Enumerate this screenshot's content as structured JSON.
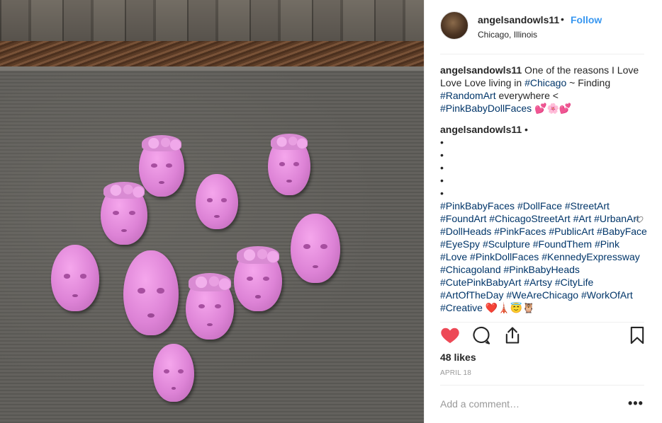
{
  "post": {
    "username": "angelsandowls11",
    "dot": "•",
    "follow_label": "Follow",
    "location": "Chicago, Illinois"
  },
  "caption": {
    "user": "angelsandowls11",
    "text_1": " One of the reasons I Love Love Love living in ",
    "tag_chicago": "#Chicago",
    "text_2": " ~ Finding ",
    "tag_randomart": "#RandomArt",
    "text_3": " everywhere < ",
    "tag_pinkbabydollfaces": "#PinkBabyDollFaces",
    "emoji_1": " 💕🌸💕"
  },
  "comment": {
    "user": "angelsandowls11",
    "dot": " •",
    "bullets": [
      "•",
      "•",
      "•",
      "•",
      "•"
    ],
    "hashtags": [
      "#PinkBabyFaces",
      "#DollFace",
      "#StreetArt",
      "#FoundArt",
      "#ChicagoStreetArt",
      "#Art",
      "#UrbanArt",
      "#DollHeads",
      "#PinkFaces",
      "#PublicArt",
      "#BabyFace",
      "#EyeSpy",
      "#Sculpture",
      "#FoundThem",
      "#Pink",
      "#Love",
      "#PinkDollFaces",
      "#KennedyExpressway",
      "#Chicagoland",
      "#PinkBabyHeads",
      "#CutePinkBabyArt",
      "#Artsy",
      "#CityLife",
      "#ArtOfTheDay",
      "#WeAreChicago",
      "#WorkOfArt",
      "#Creative"
    ],
    "trailing_emoji": " ❤️🗼😇🦉"
  },
  "actions": {
    "likes": "48 likes",
    "date": "APRIL 18",
    "comment_placeholder": "Add a comment…",
    "more": "•••"
  },
  "colors": {
    "link": "#003569",
    "follow": "#3897f0",
    "heart": "#ed4956"
  },
  "icons": [
    "heart-icon",
    "comment-icon",
    "share-icon",
    "bookmark-icon",
    "small-heart-icon",
    "more-options-icon"
  ]
}
